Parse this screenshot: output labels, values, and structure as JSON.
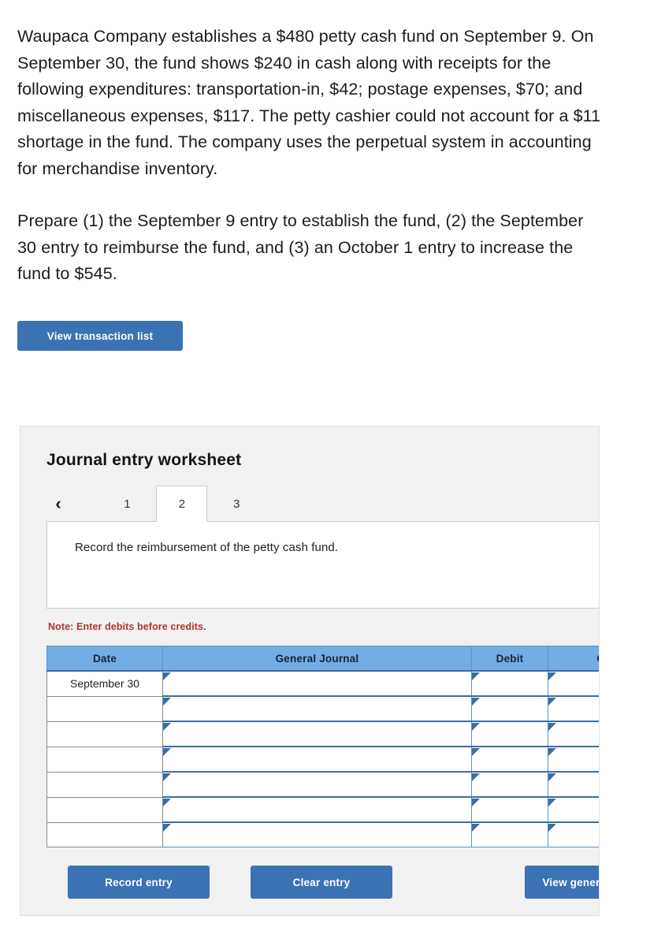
{
  "problem": {
    "paragraph_1": "Waupaca Company establishes a $480 petty cash fund on September 9. On September 30, the fund shows $240 in cash along with receipts for the following expenditures: transportation-in, $42; postage expenses, $70; and miscellaneous expenses, $117. The petty cashier could not account for a $11 shortage in the fund. The company uses the perpetual system in accounting for merchandise inventory.",
    "paragraph_2": "Prepare (1) the September 9 entry to establish the fund, (2) the September 30 entry to reimburse the fund, and (3) an October 1 entry to increase the fund to $545."
  },
  "view_transaction_list_label": "View transaction list",
  "worksheet": {
    "title": "Journal entry worksheet",
    "back_icon": "chevron-left-icon",
    "back_glyph": "‹",
    "tabs": [
      {
        "label": "1",
        "active": false
      },
      {
        "label": "2",
        "active": true
      },
      {
        "label": "3",
        "active": false
      }
    ],
    "instruction": "Record the reimbursement of the petty cash fund.",
    "note": "Note: Enter debits before credits.",
    "table": {
      "columns": [
        "Date",
        "General Journal",
        "Debit",
        "Credit"
      ],
      "rows": [
        {
          "date": "September 30",
          "general_journal": "",
          "debit": "",
          "credit": ""
        },
        {
          "date": "",
          "general_journal": "",
          "debit": "",
          "credit": ""
        },
        {
          "date": "",
          "general_journal": "",
          "debit": "",
          "credit": ""
        },
        {
          "date": "",
          "general_journal": "",
          "debit": "",
          "credit": ""
        },
        {
          "date": "",
          "general_journal": "",
          "debit": "",
          "credit": ""
        },
        {
          "date": "",
          "general_journal": "",
          "debit": "",
          "credit": ""
        },
        {
          "date": "",
          "general_journal": "",
          "debit": "",
          "credit": ""
        }
      ]
    },
    "actions": {
      "record_entry": "Record entry",
      "clear_entry": "Clear entry",
      "view_general_journal": "View general journal"
    }
  },
  "colors": {
    "button_blue": "#3b72b3",
    "table_header_blue": "#74ace4",
    "note_red": "#b03434",
    "card_background": "#f1f1f1"
  }
}
